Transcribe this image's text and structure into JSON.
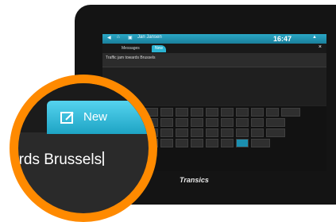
{
  "brand": "Transics",
  "statusbar": {
    "left_icons": [
      "back-arrow",
      "home",
      "app"
    ],
    "title": "Jan Jansen",
    "time": "16:47"
  },
  "tabs": [
    {
      "label": "Messages",
      "active": false
    },
    {
      "label": "New",
      "active": true
    }
  ],
  "message": {
    "text": "Traffic jam towards Brussels"
  },
  "zoom": {
    "tab_label": "New",
    "text": "ards Brussels"
  },
  "keyboard": {
    "rows": [
      [
        "",
        "",
        "",
        "",
        "",
        "",
        "",
        "",
        "",
        "",
        "",
        ""
      ],
      [
        "",
        "",
        "",
        "",
        "",
        "",
        "",
        "",
        "",
        "",
        ""
      ],
      [
        "",
        "",
        "",
        "",
        "",
        "",
        "",
        "",
        "",
        "",
        ""
      ],
      [
        "",
        "",
        "",
        "",
        "",
        "",
        "",
        "",
        "",
        ""
      ]
    ]
  }
}
